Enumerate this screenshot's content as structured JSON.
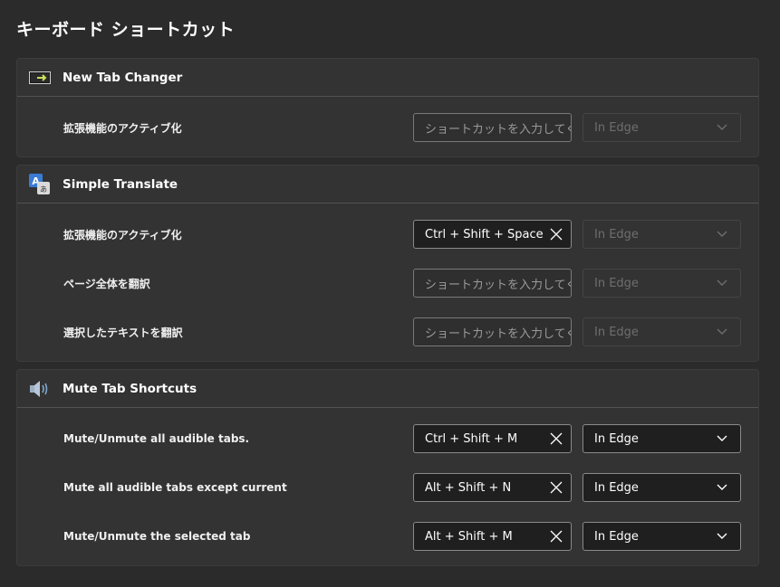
{
  "page": {
    "title": "キーボード ショートカット"
  },
  "extensions": [
    {
      "name": "New Tab Changer",
      "icon": "tab-arrow-icon",
      "commands": [
        {
          "label": "拡張機能のアクティブ化",
          "shortcut": "",
          "placeholder": "ショートカットを入力してください",
          "scope": "In Edge",
          "scope_enabled": false
        }
      ]
    },
    {
      "name": "Simple Translate",
      "icon": "translate-icon",
      "commands": [
        {
          "label": "拡張機能のアクティブ化",
          "shortcut": "Ctrl + Shift + Space",
          "placeholder": "",
          "scope": "In Edge",
          "scope_enabled": false
        },
        {
          "label": "ページ全体を翻訳",
          "shortcut": "",
          "placeholder": "ショートカットを入力してください",
          "scope": "In Edge",
          "scope_enabled": false
        },
        {
          "label": "選択したテキストを翻訳",
          "shortcut": "",
          "placeholder": "ショートカットを入力してください",
          "scope": "In Edge",
          "scope_enabled": false
        }
      ]
    },
    {
      "name": "Mute Tab Shortcuts",
      "icon": "speaker-icon",
      "commands": [
        {
          "label": "Mute/Unmute all audible tabs.",
          "shortcut": "Ctrl + Shift + M",
          "placeholder": "",
          "scope": "In Edge",
          "scope_enabled": true
        },
        {
          "label": "Mute all audible tabs except current",
          "shortcut": "Alt + Shift + N",
          "placeholder": "",
          "scope": "In Edge",
          "scope_enabled": true
        },
        {
          "label": "Mute/Unmute the selected tab",
          "shortcut": "Alt + Shift + M",
          "placeholder": "",
          "scope": "In Edge",
          "scope_enabled": true
        }
      ]
    }
  ]
}
